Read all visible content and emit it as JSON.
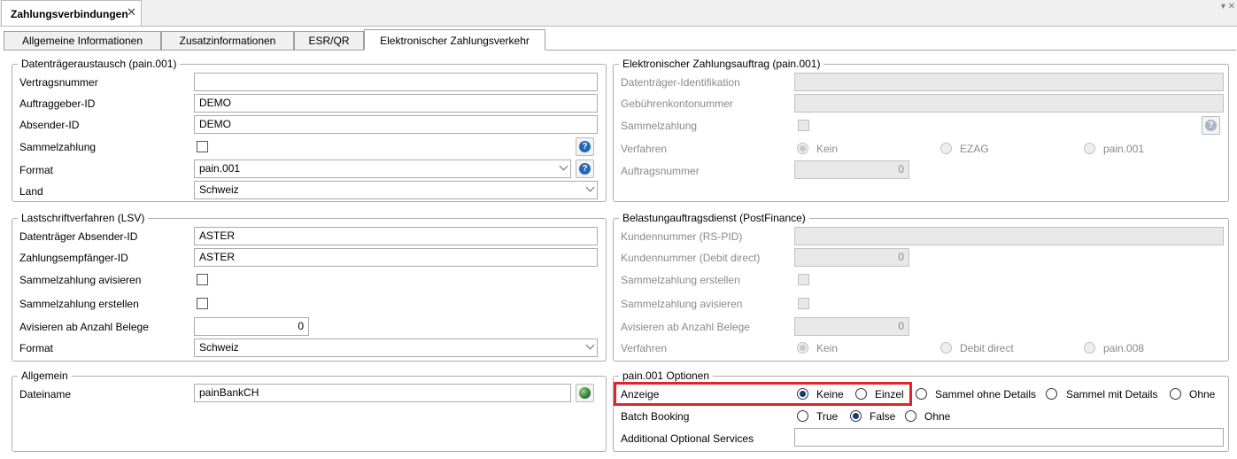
{
  "window": {
    "doc_tab_title": "Zahlungsverbindungen",
    "close_glyph": "✕",
    "ctrl_glyph": "▾ ✕"
  },
  "tabs": [
    "Allgemeine Informationen",
    "Zusatzinformationen",
    "ESR/QR",
    "Elektronischer Zahlungsverkehr"
  ],
  "dta": {
    "legend": "Datenträgeraustausch (pain.001)",
    "vertragsnummer_label": "Vertragsnummer",
    "vertragsnummer_value": "",
    "auftraggeber_label": "Auftraggeber-ID",
    "auftraggeber_value": "DEMO",
    "absender_label": "Absender-ID",
    "absender_value": "DEMO",
    "sammelzahlung_label": "Sammelzahlung",
    "format_label": "Format",
    "format_value": "pain.001",
    "land_label": "Land",
    "land_value": "Schweiz"
  },
  "lsv": {
    "legend": "Lastschriftverfahren (LSV)",
    "absender_label": "Datenträger Absender-ID",
    "absender_value": "ASTER",
    "empfaenger_label": "Zahlungsempfänger-ID",
    "empfaenger_value": "ASTER",
    "avisieren_label": "Sammelzahlung avisieren",
    "erstellen_label": "Sammelzahlung erstellen",
    "anzahl_label": "Avisieren ab Anzahl Belege",
    "anzahl_value": "0",
    "format_label": "Format",
    "format_value": "Schweiz"
  },
  "allgemein": {
    "legend": "Allgemein",
    "dateiname_label": "Dateiname",
    "dateiname_value": "painBankCH"
  },
  "eza": {
    "legend": "Elektronischer Zahlungsauftrag (pain.001)",
    "dt_id_label": "Datenträger-Identifikation",
    "gebuehren_label": "Gebührenkontonummer",
    "sammelzahlung_label": "Sammelzahlung",
    "verfahren_label": "Verfahren",
    "verfahren_options": [
      "Kein",
      "EZAG",
      "pain.001"
    ],
    "auftragsnummer_label": "Auftragsnummer",
    "auftragsnummer_value": "0"
  },
  "bad": {
    "legend": "Belastungauftragsdienst (PostFinance)",
    "kunden_rs_label": "Kundennummer (RS-PID)",
    "kunden_dd_label": "Kundennummer (Debit direct)",
    "kunden_dd_value": "0",
    "erstellen_label": "Sammelzahlung erstellen",
    "avisieren_label": "Sammelzahlung avisieren",
    "anzahl_label": "Avisieren ab Anzahl Belege",
    "anzahl_value": "0",
    "verfahren_label": "Verfahren",
    "verfahren_options": [
      "Kein",
      "Debit direct",
      "pain.008"
    ]
  },
  "pain": {
    "legend": "pain.001 Optionen",
    "anzeige_label": "Anzeige",
    "anzeige_options": [
      "Keine",
      "Einzel",
      "Sammel ohne Details",
      "Sammel mit Details",
      "Ohne"
    ],
    "batch_label": "Batch Booking",
    "batch_options": [
      "True",
      "False",
      "Ohne"
    ],
    "services_label": "Additional Optional Services"
  },
  "colors": {
    "highlight": "#e0242f",
    "help_blue": "#2068b8"
  }
}
